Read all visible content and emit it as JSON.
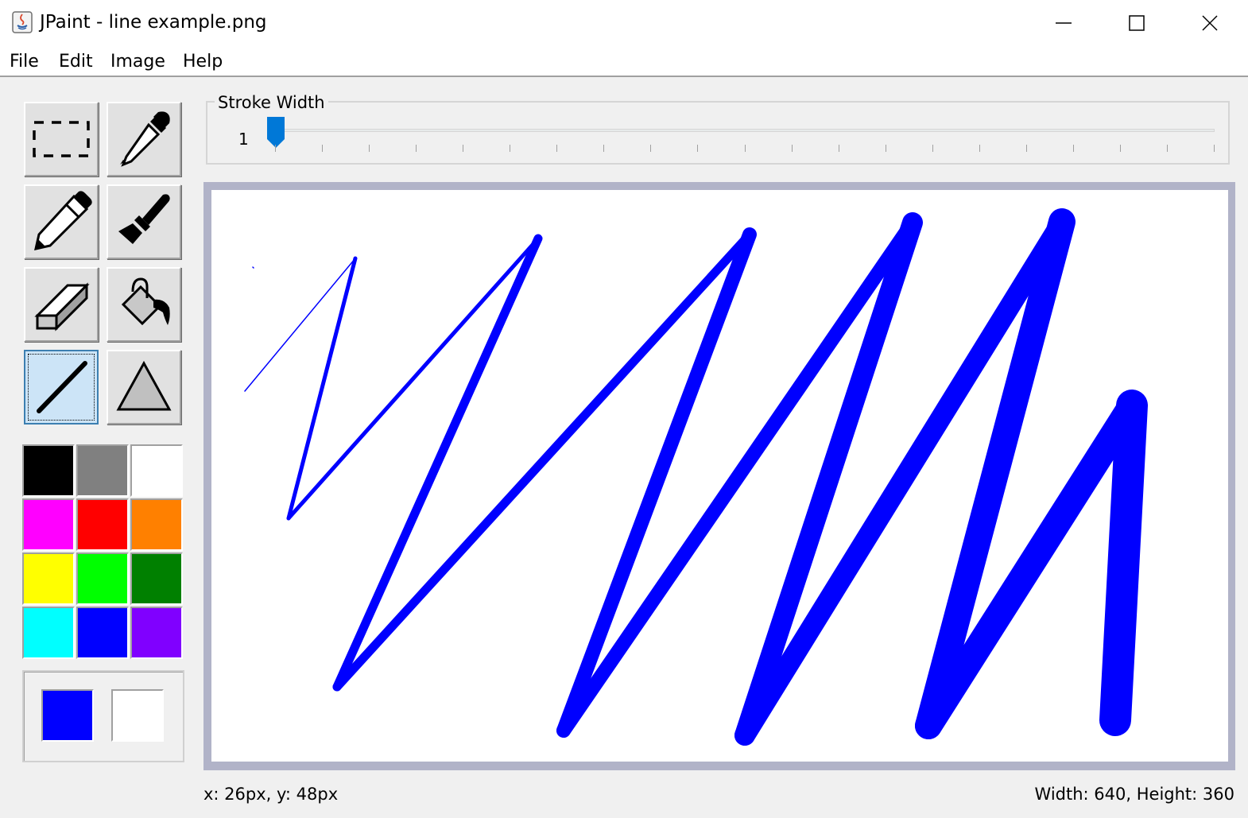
{
  "window": {
    "title": "JPaint - line example.png",
    "controls": [
      "minimize",
      "maximize",
      "close"
    ]
  },
  "menu": {
    "items": [
      "File",
      "Edit",
      "Image",
      "Help"
    ]
  },
  "tools": [
    {
      "name": "select",
      "icon": "dashed-rect-icon",
      "active": false
    },
    {
      "name": "eyedropper",
      "icon": "eyedropper-icon",
      "active": false
    },
    {
      "name": "pencil",
      "icon": "pencil-icon",
      "active": false
    },
    {
      "name": "brush",
      "icon": "paintbrush-icon",
      "active": false
    },
    {
      "name": "eraser",
      "icon": "eraser-icon",
      "active": false
    },
    {
      "name": "fill",
      "icon": "paint-bucket-icon",
      "active": false
    },
    {
      "name": "line",
      "icon": "line-icon",
      "active": true
    },
    {
      "name": "shape",
      "icon": "triangle-icon",
      "active": false
    }
  ],
  "palette": {
    "colors": [
      "#000000",
      "#808080",
      "#ffffff",
      "#ff00ff",
      "#ff0000",
      "#ff8000",
      "#ffff00",
      "#00ff00",
      "#008000",
      "#00ffff",
      "#0000ff",
      "#8000ff"
    ]
  },
  "current_colors": {
    "primary": "#0000ff",
    "secondary": "#ffffff"
  },
  "stroke": {
    "label": "Stroke Width",
    "value": "1",
    "thumb_color": "#0078d7"
  },
  "drawing": {
    "stroke_color": "#0000ff"
  },
  "status": {
    "cursor": "x: 26px, y: 48px",
    "size": "Width: 640, Height: 360"
  }
}
